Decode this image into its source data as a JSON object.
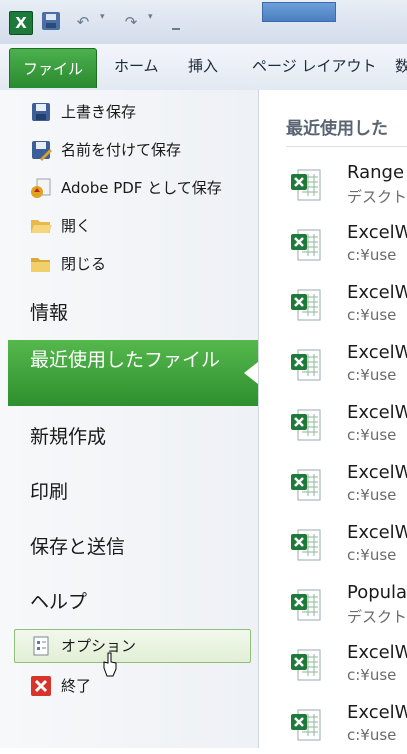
{
  "title_bar": {
    "app_logo": "X",
    "quick_access": [
      "save-icon",
      "undo-icon",
      "redo-icon",
      "customize-icon"
    ]
  },
  "ribbon": {
    "file_tab": "ファイル",
    "tabs": [
      "ホーム",
      "挿入",
      "ページ レイアウト",
      "数"
    ]
  },
  "backstage": {
    "commands": [
      {
        "label": "上書き保存",
        "icon": "save-icon"
      },
      {
        "label": "名前を付けて保存",
        "icon": "save-as-icon"
      },
      {
        "label": "Adobe PDF として保存",
        "icon": "adobe-pdf-icon"
      },
      {
        "label": "開く",
        "icon": "open-folder-icon"
      },
      {
        "label": "閉じる",
        "icon": "close-folder-icon"
      }
    ],
    "nav": {
      "info": "情報",
      "recent": "最近使用したファイル",
      "new": "新規作成",
      "print": "印刷",
      "save_send": "保存と送信",
      "help": "ヘルプ"
    },
    "bottom": {
      "options": "オプション",
      "exit": "終了"
    }
  },
  "recent": {
    "title": "最近使用した",
    "docs": [
      {
        "name": "Range",
        "path": "デスクト"
      },
      {
        "name": "ExcelW",
        "path": "c:¥use"
      },
      {
        "name": "ExcelW",
        "path": "c:¥use"
      },
      {
        "name": "ExcelW",
        "path": "c:¥use"
      },
      {
        "name": "ExcelW",
        "path": "c:¥use"
      },
      {
        "name": "ExcelW",
        "path": "c:¥use"
      },
      {
        "name": "ExcelW",
        "path": "c:¥use"
      },
      {
        "name": "Popula",
        "path": "デスクト"
      },
      {
        "name": "ExcelW",
        "path": "c:¥use"
      },
      {
        "name": "ExcelW",
        "path": "c:¥use"
      }
    ]
  },
  "colors": {
    "accent_green": "#2e8f2e",
    "ribbon_blue": "#4a7fc0"
  }
}
